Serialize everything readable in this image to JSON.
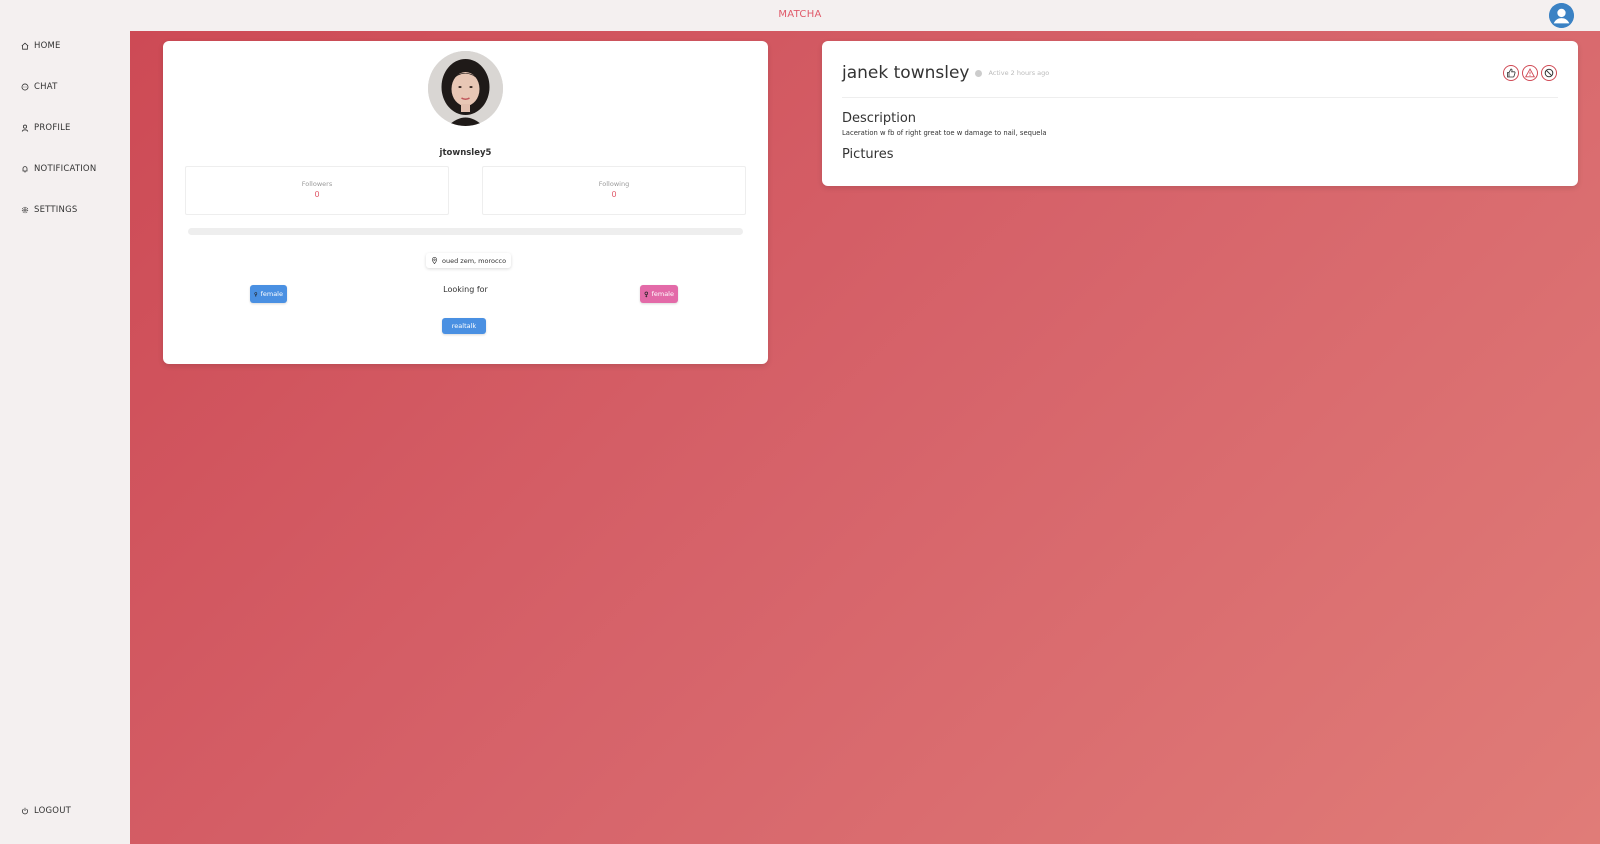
{
  "app": {
    "brand": "MATCHA"
  },
  "sidebar": {
    "items": [
      {
        "label": "HOME",
        "icon": "home-icon"
      },
      {
        "label": "CHAT",
        "icon": "chat-icon"
      },
      {
        "label": "PROFILE",
        "icon": "user-icon"
      },
      {
        "label": "NOTIFICATION",
        "icon": "bell-icon"
      },
      {
        "label": "SETTINGS",
        "icon": "gear-icon"
      }
    ],
    "logout": {
      "label": "LOGOUT",
      "icon": "power-icon"
    }
  },
  "profile": {
    "username": "jtownsley5",
    "followers_label": "Followers",
    "followers_value": "0",
    "following_label": "Following",
    "following_value": "0",
    "fame_progress_percent": 0,
    "location": "oued zem, morocco",
    "gender_tag": "female",
    "looking_for_label": "Looking for",
    "preference_tag": "female",
    "interest_tag": "realtalk"
  },
  "detail": {
    "full_name": "janek townsley",
    "active_status": "Active 2 hours ago",
    "description_heading": "Description",
    "description_text": "Laceration w fb of right great toe w damage to nail, sequela",
    "pictures_heading": "Pictures",
    "actions": [
      "like-icon",
      "report-icon",
      "block-icon"
    ]
  },
  "colors": {
    "accent": "#e05a6a",
    "blue_tag": "#4a90e2",
    "pink_tag": "#e36aa8",
    "background_gradient_start": "#cd4a55",
    "background_gradient_end": "#e07c78"
  }
}
